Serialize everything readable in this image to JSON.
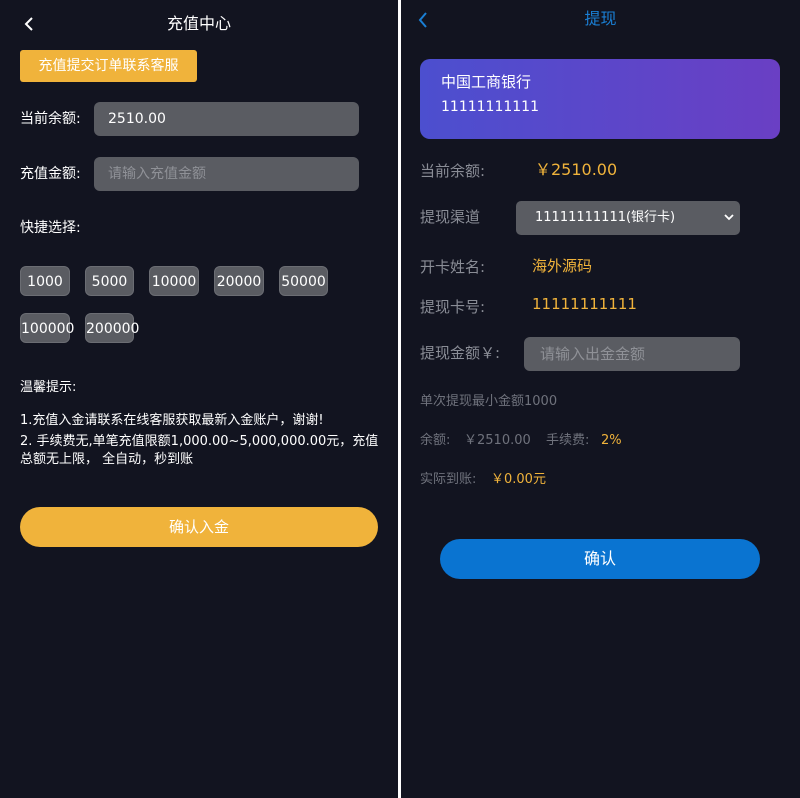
{
  "deposit": {
    "header": {
      "title": "充值中心",
      "back_icon": "chevron-left-icon"
    },
    "notice_button": "充值提交订单联系客服",
    "balance": {
      "label": "当前余额:",
      "value": "2510.00"
    },
    "amount": {
      "label": "充值金额:",
      "placeholder": "请输入充值金额"
    },
    "quick": {
      "label": "快捷选择:",
      "options": [
        "1000",
        "5000",
        "10000",
        "20000",
        "50000",
        "100000",
        "200000"
      ]
    },
    "tips": {
      "title": "温馨提示:",
      "lines": [
        "1.充值入金请联系在线客服获取最新入金账户，谢谢!",
        "2. 手续费无,单笔充值限额1,000.00~5,000,000.00元，充值总额无上限， 全自动，秒到账"
      ]
    },
    "confirm_button": "确认入金",
    "colors": {
      "accent": "#f0b33b",
      "background": "#121420",
      "field": "#5a5c62"
    }
  },
  "withdraw": {
    "header": {
      "title": "提现",
      "back_icon": "chevron-left-icon"
    },
    "card": {
      "bank": "中国工商银行",
      "number": "11111111111"
    },
    "balance": {
      "label": "当前余额:",
      "value": "￥2510.00"
    },
    "channel": {
      "label": "提现渠道",
      "selected": "11111111111(银行卡)"
    },
    "holder": {
      "label": "开卡姓名:",
      "value": "海外源码"
    },
    "card_no": {
      "label": "提现卡号:",
      "value": "11111111111"
    },
    "amount": {
      "label": "提现金额￥:",
      "placeholder": "请输入出金金额"
    },
    "min_note": "单次提现最小金额1000",
    "summary": {
      "balance_label": "余额:",
      "balance_value": "￥2510.00",
      "fee_label": "手续费:",
      "fee_value": "2%"
    },
    "actual": {
      "label": "实际到账:",
      "value": "￥0.00元"
    },
    "confirm_button": "确认",
    "colors": {
      "accent": "#1a7fd4",
      "button": "#0a74d1",
      "card_start": "#4c4fcf",
      "card_end": "#6a3fc4"
    }
  }
}
